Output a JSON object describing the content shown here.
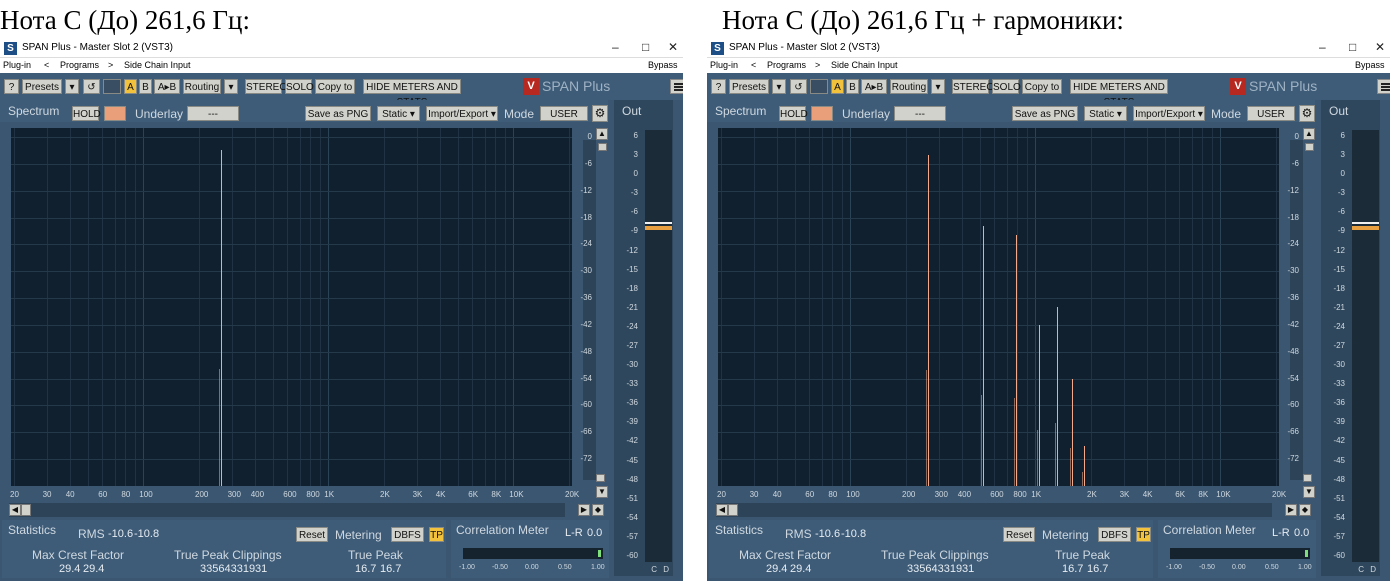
{
  "captions": {
    "left": "Нота C (До) 261,6 Гц:",
    "right": "Нота C (До) 261,6 Гц + гармоники:"
  },
  "window": {
    "title": "SPAN Plus - Master Slot 2 (VST3)",
    "app_icon": "S",
    "minimize": "–",
    "maximize": "□",
    "close": "✕"
  },
  "menu": {
    "plugin": "Plug-in",
    "prev": "<",
    "programs": "Programs",
    "next": ">",
    "sidechain": "Side Chain Input",
    "bypass": "Bypass"
  },
  "toolbar": {
    "help": "?",
    "presets": "Presets",
    "dropdown": "▾",
    "reset_icon": "↺",
    "a": "A",
    "b": "B",
    "ab": "A▸B",
    "routing": "Routing",
    "stereo": "STEREO",
    "solo": "SOLO",
    "copyto": "Copy to",
    "hide": "HIDE METERS AND STATS",
    "logo_mark": "V",
    "logo_text": "SPAN Plus"
  },
  "spectrum": {
    "tab": "Spectrum",
    "hold": "HOLD",
    "underlay": "Underlay",
    "underlay_value": "---",
    "save": "Save as PNG",
    "static": "Static ▾",
    "import": "Import/Export ▾",
    "mode": "Mode",
    "mode_value": "USER"
  },
  "axes": {
    "x_ticks": [
      "20",
      "30",
      "40",
      "60",
      "80",
      "100",
      "200",
      "300",
      "400",
      "600",
      "800",
      "1K",
      "2K",
      "3K",
      "4K",
      "6K",
      "8K",
      "10K",
      "20K"
    ],
    "y_ticks": [
      "0",
      "-6",
      "-12",
      "-18",
      "-24",
      "-30",
      "-36",
      "-42",
      "-48",
      "-54",
      "-60",
      "-66",
      "-72"
    ]
  },
  "out": {
    "label": "Out",
    "ticks": [
      "6",
      "3",
      "0",
      "-3",
      "-6",
      "-9",
      "-12",
      "-15",
      "-18",
      "-21",
      "-24",
      "-27",
      "-30",
      "-33",
      "-36",
      "-39",
      "-42",
      "-45",
      "-48",
      "-51",
      "-54",
      "-57",
      "-60"
    ],
    "channels": [
      "C",
      "D"
    ],
    "level_db": -7.5,
    "colors": {
      "peak": "#f0f0f0",
      "rms": "#e8a040"
    }
  },
  "stats": {
    "tab": "Statistics",
    "rms_label": "RMS",
    "rms_l": "-10.6",
    "rms_r": "-10.8",
    "reset": "Reset",
    "metering": "Metering",
    "dbfs": "DBFS",
    "tp": "TP",
    "crest_label": "Max Crest Factor",
    "crest_l": "29.4",
    "crest_r": "29.4",
    "clip_label": "True Peak Clippings",
    "clip_value": "33564331931",
    "truepeak_label": "True Peak",
    "tp_l": "16.7",
    "tp_r": "16.7"
  },
  "correlation": {
    "title": "Correlation Meter",
    "mode": "L-R",
    "value": "0.0",
    "ticks": [
      "-1.00",
      "-0.50",
      "0.00",
      "0.50",
      "1.00"
    ]
  },
  "chart_data": [
    {
      "type": "bar",
      "title": "",
      "xscale": "log",
      "xlim": [
        20,
        20000
      ],
      "ylim": [
        -78,
        2
      ],
      "x": [
        261.6
      ],
      "values": [
        -3
      ]
    },
    {
      "type": "bar",
      "title": "",
      "xscale": "log",
      "xlim": [
        20,
        20000
      ],
      "ylim": [
        -78,
        2
      ],
      "x": [
        261.6,
        523.2,
        784.8,
        1046.4,
        1308,
        1569.6,
        1831.2
      ],
      "values": [
        -4,
        -20,
        -22,
        -42,
        -38,
        -54,
        -69
      ]
    }
  ],
  "colors": {
    "panel": "#3b5670",
    "plot_bg": "#10202e",
    "peak": "#f4a98a",
    "accent": "#f2c23c"
  }
}
